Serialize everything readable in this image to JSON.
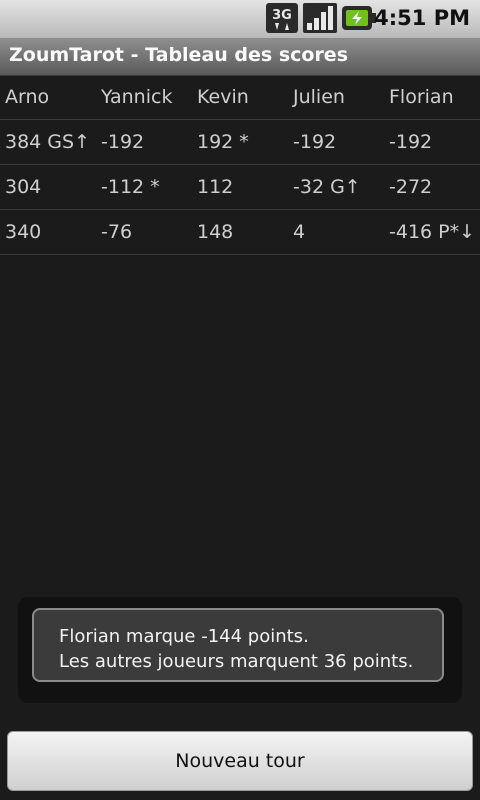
{
  "status_bar": {
    "time": "4:51 PM",
    "network_icon": "3g-icon",
    "signal_icon": "signal-bars-icon",
    "battery_icon": "battery-charging-icon"
  },
  "app": {
    "title": "ZoumTarot - Tableau des scores"
  },
  "scores": {
    "headers": [
      "Arno",
      "Yannick",
      "Kevin",
      "Julien",
      "Florian"
    ],
    "rows": [
      [
        "384 GS↑",
        "-192",
        "192 *",
        "-192",
        "-192"
      ],
      [
        "304",
        "-112 *",
        "112",
        "-32 G↑",
        "-272"
      ],
      [
        "340",
        "-76",
        "148",
        "4",
        "-416 P*↓"
      ]
    ]
  },
  "toast": {
    "line1": "Florian marque -144 points.",
    "line2": "Les autres joueurs marquent 36 points."
  },
  "actions": {
    "new_round_label": "Nouveau tour"
  }
}
